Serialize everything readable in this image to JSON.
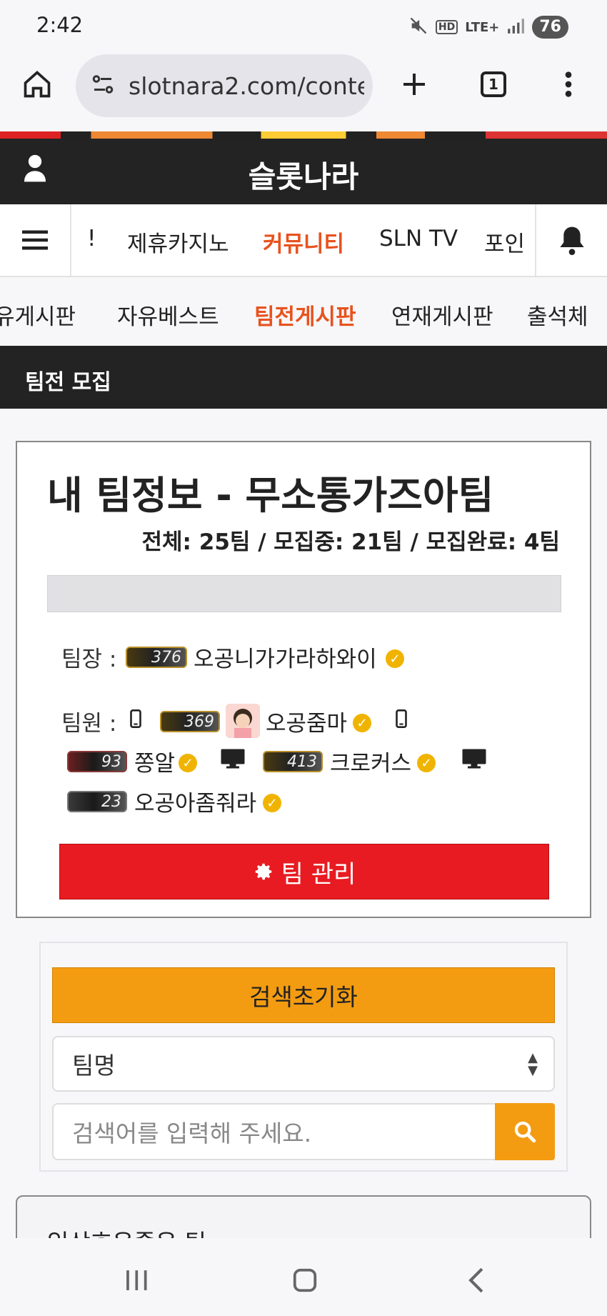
{
  "status_bar": {
    "time": "2:42",
    "network": "LTE+",
    "hd": "HD",
    "battery": "76"
  },
  "browser": {
    "url": "slotnara2.com/conte",
    "tab_count": "1"
  },
  "site": {
    "title": "슬롯나라"
  },
  "main_nav": {
    "items": [
      {
        "label": "!"
      },
      {
        "label": "제휴카지노"
      },
      {
        "label": "커뮤니티",
        "active": true
      },
      {
        "label": "SLN TV"
      },
      {
        "label": "포인"
      }
    ]
  },
  "sub_nav": {
    "items": [
      {
        "label": "유게시판"
      },
      {
        "label": "자유베스트"
      },
      {
        "label": "팀전게시판",
        "active": true
      },
      {
        "label": "연재게시판"
      },
      {
        "label": "출석체"
      }
    ]
  },
  "section": {
    "title": "팀전 모집"
  },
  "team": {
    "title": "내 팀정보 - 무소통가즈아팀",
    "stats": "전체: 25팀 / 모집중: 21팀 / 모집완료: 4팀",
    "leader_label": "팀장 :",
    "leader": {
      "level": "376",
      "name": "오공니가가라하와이"
    },
    "members_label": "팀원 :",
    "members": [
      {
        "level": "369",
        "name": "오공줌마"
      },
      {
        "level": "93",
        "name": "쫑알"
      },
      {
        "level": "413",
        "name": "크로커스"
      },
      {
        "level": "23",
        "name": "오공아좀줘라"
      }
    ],
    "manage_button": "팀 관리"
  },
  "search": {
    "reset_button": "검색초기화",
    "select_value": "팀명",
    "input_placeholder": "검색어를 입력해 주세요."
  },
  "next_card": {
    "title": "입상호은줄은 팀"
  },
  "colors": {
    "accent": "#e8521e",
    "danger": "#e81b22",
    "warning": "#f39c12",
    "dark": "#232323"
  }
}
